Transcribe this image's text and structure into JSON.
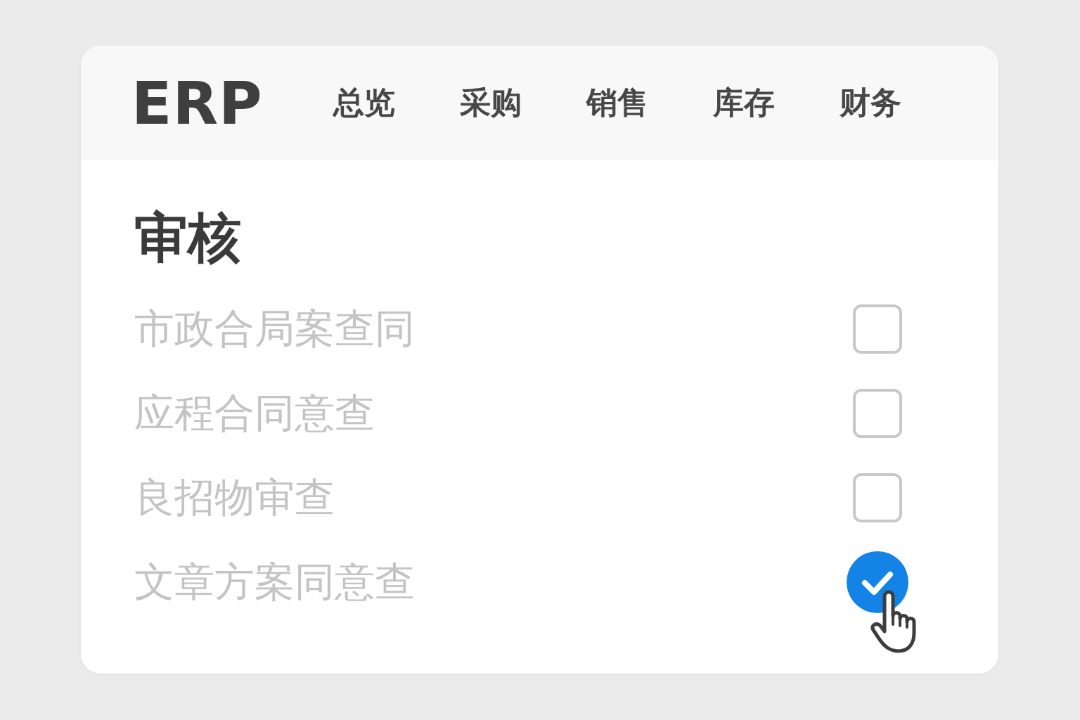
{
  "header": {
    "logo": "ERP",
    "nav": [
      "总览",
      "采购",
      "销售",
      "库存",
      "财务"
    ]
  },
  "section": {
    "title": "审核"
  },
  "items": [
    {
      "label": "市政合局案查同",
      "checked": false
    },
    {
      "label": "应程合同意查",
      "checked": false
    },
    {
      "label": "良招物审查",
      "checked": false
    },
    {
      "label": "文章方案同意查",
      "checked": true
    }
  ],
  "cursor": {
    "kind": "hand"
  }
}
